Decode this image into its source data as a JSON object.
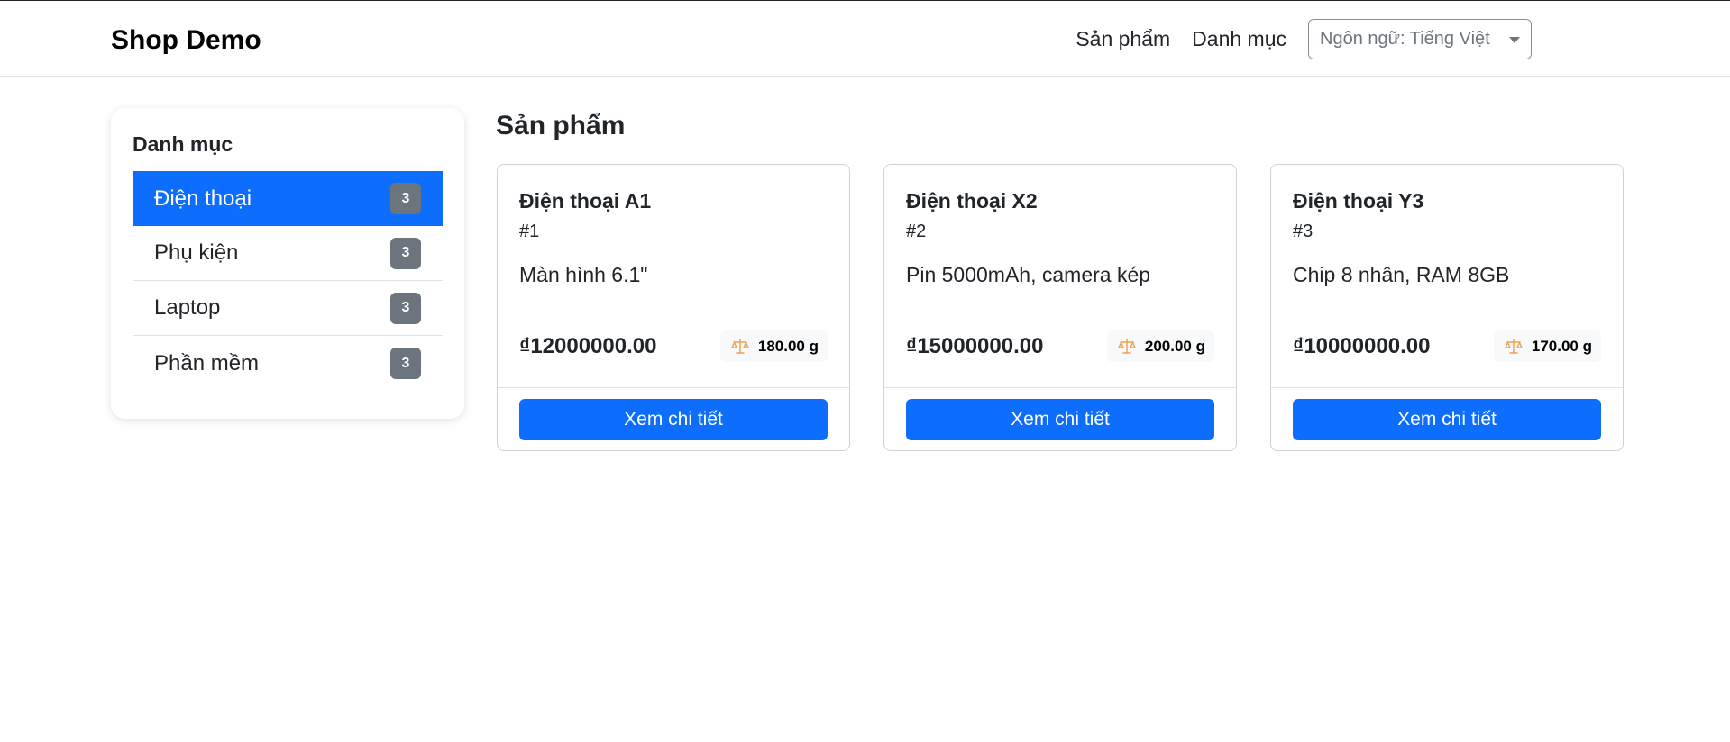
{
  "navbar": {
    "brand": "Shop Demo",
    "links": [
      "Sản phẩm",
      "Danh mục"
    ],
    "language_select": {
      "value": "Ngôn ngữ: Tiếng Việt"
    }
  },
  "sidebar": {
    "title": "Danh mục",
    "items": [
      {
        "label": "Điện thoại",
        "count": "3",
        "active": true
      },
      {
        "label": "Phụ kiện",
        "count": "3",
        "active": false
      },
      {
        "label": "Laptop",
        "count": "3",
        "active": false
      },
      {
        "label": "Phần mềm",
        "count": "3",
        "active": false
      }
    ]
  },
  "main": {
    "title": "Sản phẩm",
    "products": [
      {
        "name": "Điện thoại A1",
        "id": "#1",
        "description": "Màn hình 6.1\"",
        "price": "₫12000000.00",
        "weight": "180.00 g",
        "button": "Xem chi tiết"
      },
      {
        "name": "Điện thoại X2",
        "id": "#2",
        "description": "Pin 5000mAh, camera kép",
        "price": "₫15000000.00",
        "weight": "200.00 g",
        "button": "Xem chi tiết"
      },
      {
        "name": "Điện thoại Y3",
        "id": "#3",
        "description": "Chip 8 nhân, RAM 8GB",
        "price": "₫10000000.00",
        "weight": "170.00 g",
        "button": "Xem chi tiết"
      }
    ]
  },
  "colors": {
    "primary": "#0d6efd",
    "badge": "#6c757d",
    "scale_icon": "#f0a050"
  },
  "icons": {
    "weight": "scale-icon",
    "dropdown": "caret-down-icon"
  }
}
